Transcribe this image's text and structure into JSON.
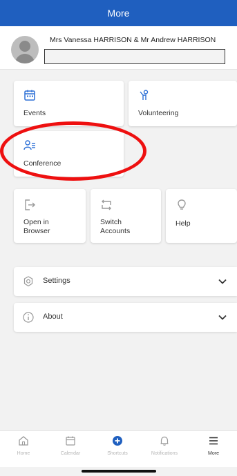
{
  "header": {
    "title": "More"
  },
  "profile": {
    "name": "Mrs Vanessa HARRISON & Mr Andrew HARRISON",
    "field_value": ""
  },
  "grid": {
    "events_label": "Events",
    "volunteering_label": "Volunteering",
    "conference_label": "Conference"
  },
  "shortcuts": {
    "open_browser_line1": "Open in",
    "open_browser_line2": "Browser",
    "switch_accounts_line1": "Switch",
    "switch_accounts_line2": "Accounts",
    "help_label": "Help"
  },
  "sections": {
    "settings_label": "Settings",
    "about_label": "About"
  },
  "tabbar": {
    "home_label": "Home",
    "calendar_label": "Calendar",
    "shortcuts_label": "Shortcuts",
    "notifications_label": "Notifications",
    "more_label": "More"
  },
  "colors": {
    "brand_blue": "#1f5fbf",
    "highlight_red": "#ee1010",
    "icon_blue": "#2b6fd6"
  }
}
